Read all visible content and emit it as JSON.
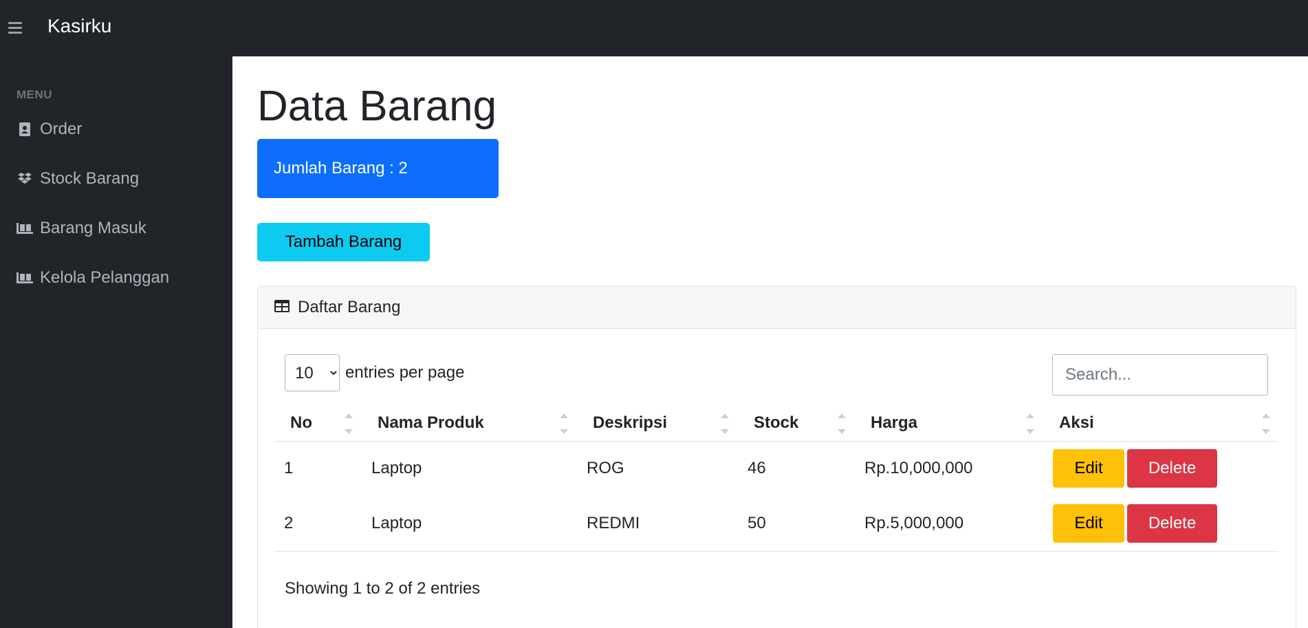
{
  "app": {
    "brand": "Kasirku"
  },
  "sidebar": {
    "heading": "MENU",
    "items": [
      {
        "label": "Order",
        "icon": "address-book-icon"
      },
      {
        "label": "Stock Barang",
        "icon": "dropbox-icon"
      },
      {
        "label": "Barang Masuk",
        "icon": "dolly-icon"
      },
      {
        "label": "Kelola Pelanggan",
        "icon": "dolly-icon"
      }
    ]
  },
  "main": {
    "title": "Data Barang",
    "count_label": "Jumlah Barang : 2",
    "add_button": "Tambah Barang"
  },
  "table_card": {
    "header": "Daftar Barang",
    "per_page_value": "10",
    "per_page_label": "entries per page",
    "search_placeholder": "Search...",
    "columns": [
      "No",
      "Nama Produk",
      "Deskripsi",
      "Stock",
      "Harga",
      "Aksi"
    ],
    "rows": [
      {
        "no": "1",
        "nama": "Laptop",
        "deskripsi": "ROG",
        "stock": "46",
        "harga": "Rp.10,000,000",
        "edit": "Edit",
        "delete": "Delete"
      },
      {
        "no": "2",
        "nama": "Laptop",
        "deskripsi": "REDMI",
        "stock": "50",
        "harga": "Rp.5,000,000",
        "edit": "Edit",
        "delete": "Delete"
      }
    ],
    "info": "Showing 1 to 2 of 2 entries"
  },
  "colors": {
    "topbar": "#212529",
    "primary": "#0d6efd",
    "info": "#0dcaf0",
    "warning": "#ffc107",
    "danger": "#dc3545"
  }
}
